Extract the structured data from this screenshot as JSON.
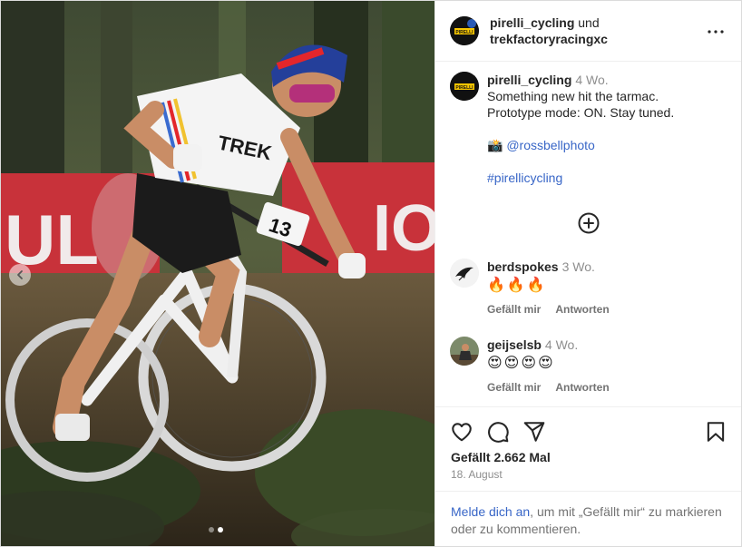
{
  "header": {
    "account": "pirelli_cycling",
    "connector": "und",
    "collaborator": "trekfactoryracingxc",
    "more_icon": "more-horizontal-icon"
  },
  "caption": {
    "username": "pirelli_cycling",
    "time": "4 Wo.",
    "line1": "Something new hit the tarmac.",
    "line2": "Prototype mode: ON. Stay tuned.",
    "camera_emoji": "📸",
    "mention": "@rossbellphoto",
    "hashtag": "#pirellicycling"
  },
  "comments": [
    {
      "username": "berdspokes",
      "time": "3 Wo.",
      "text": "🔥🔥🔥",
      "like": "Gefällt mir",
      "reply": "Antworten"
    },
    {
      "username": "geijselsb",
      "time": "4 Wo.",
      "text": "😍😍😍😍",
      "like": "Gefällt mir",
      "reply": "Antworten"
    }
  ],
  "load_more_icon": "plus-circle-icon",
  "actions": {
    "like_icon": "heart-icon",
    "comment_icon": "comment-icon",
    "share_icon": "send-icon",
    "save_icon": "bookmark-icon"
  },
  "likes": "Gefällt 2.662 Mal",
  "date": "18. August",
  "login_prompt": {
    "link": "Melde dich an",
    "text": ", um mit „Gefällt mir“ zu markieren oder zu kommentieren."
  },
  "media": {
    "bib_number": "13",
    "carousel_count": 2,
    "carousel_active": 2
  },
  "colors": {
    "link": "#3866c7",
    "muted": "#8e8e8e",
    "pirelli_yellow": "#f7c600"
  }
}
